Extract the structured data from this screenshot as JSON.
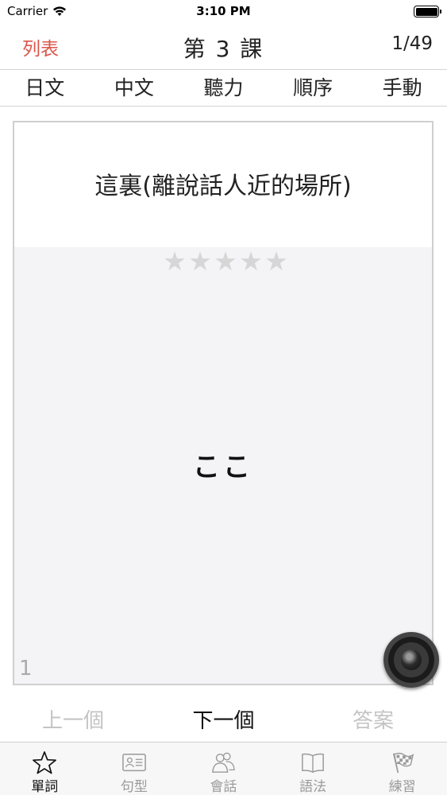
{
  "status": {
    "carrier": "Carrier",
    "time": "3:10 PM"
  },
  "nav": {
    "left": "列表",
    "title": "第 3 課",
    "right": "1/49"
  },
  "modes": [
    "日文",
    "中文",
    "聽力",
    "順序",
    "手動"
  ],
  "card": {
    "meaning": "這裏(離說話人近的場所)",
    "word": "ここ",
    "rating": 0,
    "rating_max": 5,
    "index": "1"
  },
  "actions": {
    "prev": "上一個",
    "next": "下一個",
    "answer": "答案"
  },
  "tabs": [
    {
      "label": "單詞",
      "icon": "star-icon",
      "active": true
    },
    {
      "label": "句型",
      "icon": "id-card-icon",
      "active": false
    },
    {
      "label": "會話",
      "icon": "people-icon",
      "active": false
    },
    {
      "label": "語法",
      "icon": "book-icon",
      "active": false
    },
    {
      "label": "練習",
      "icon": "checkered-flag-icon",
      "active": false
    }
  ],
  "colors": {
    "accent": "#d9574b",
    "inactive": "#c4c4c4",
    "card_bg": "#f4f4f6"
  }
}
